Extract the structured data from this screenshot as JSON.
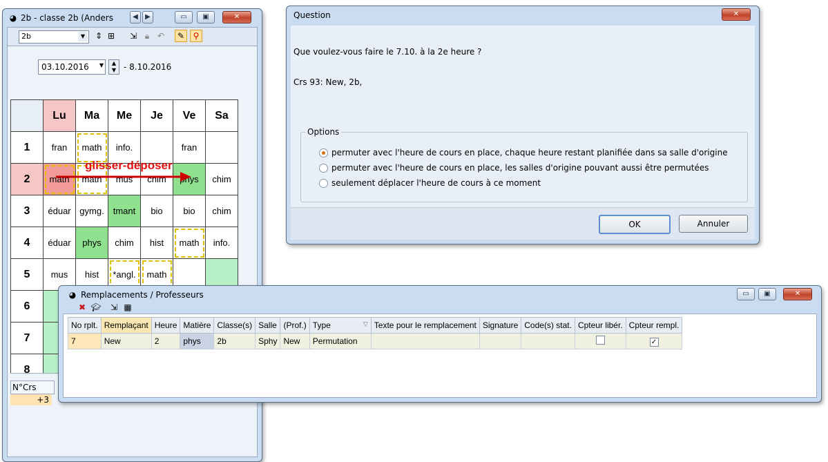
{
  "timetable_window": {
    "title": "2b - classe 2b (Anders",
    "class_select": "2b",
    "date_from": "03.10.2016",
    "date_to": "- 8.10.2016",
    "days": [
      "Lu",
      "Ma",
      "Me",
      "Je",
      "Ve",
      "Sa"
    ],
    "hours": [
      "1",
      "2",
      "3",
      "4",
      "5",
      "6",
      "7",
      "8"
    ],
    "rows": [
      [
        "fran",
        "math",
        "info.",
        "",
        "fran",
        ""
      ],
      [
        "math",
        "math",
        "mus",
        "chim",
        "phys",
        "chim"
      ],
      [
        "éduar",
        "gymg.",
        "tmant",
        "bio",
        "bio",
        "chim"
      ],
      [
        "éduar",
        "phys",
        "chim",
        "hist",
        "math",
        "info."
      ],
      [
        "mus",
        "hist",
        "*angl.",
        "math",
        "",
        ""
      ]
    ],
    "drag_label": "glisser-déposer",
    "bottom_header": "N°Crs",
    "bottom_value": "+3"
  },
  "question_dialog": {
    "title": "Question",
    "message": "Que voulez-vous faire le 7.10. à la 2e heure ?",
    "course": "Crs 93: New, 2b,",
    "options_legend": "Options",
    "options": [
      "permuter avec l'heure de cours en place, chaque heure restant planifiée dans sa salle d'origine",
      "permuter avec l'heure de cours en place, les salles d'origine pouvant aussi être permutées",
      "seulement déplacer l'heure de cours à ce moment"
    ],
    "ok_label": "OK",
    "cancel_label": "Annuler"
  },
  "remplacements_window": {
    "title": "Remplacements / Professeurs",
    "columns": [
      "No rplt.",
      "Remplaçant",
      "Heure",
      "Matière",
      "Classe(s)",
      "Salle",
      "(Prof.)",
      "Type",
      "Texte pour le remplacement",
      "Signature",
      "Code(s) stat.",
      "Cpteur libér.",
      "Cpteur rempl."
    ],
    "row": {
      "no": "7",
      "remplacant": "New",
      "heure": "2",
      "matiere": "phys",
      "classe": "2b",
      "salle": "Sphy",
      "prof": "New",
      "type": "Permutation",
      "texte": "",
      "signature": "",
      "code": "",
      "cpteur_liber": false,
      "cpteur_rempl": true
    }
  }
}
